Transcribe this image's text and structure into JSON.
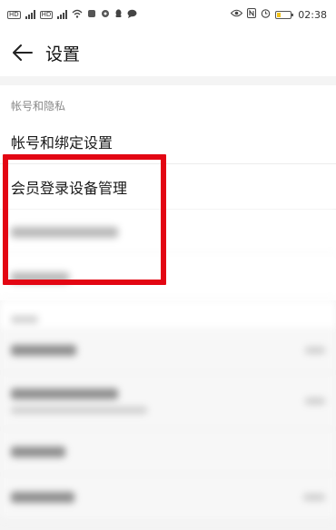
{
  "status_bar": {
    "time": "02:38",
    "left_icons": [
      "hd-icon",
      "signal-icon",
      "hd-icon",
      "signal-icon",
      "wifi-icon",
      "notification-icon",
      "location-icon",
      "qq-icon",
      "chat-icon"
    ],
    "right_icons": [
      "eye-icon",
      "nfc-icon",
      "alarm-icon",
      "battery-icon"
    ],
    "battery_level": 0.2
  },
  "header": {
    "title": "设置",
    "back_icon": "back-arrow-icon"
  },
  "account_section": {
    "header": "帐号和隐私",
    "items": [
      {
        "label": "帐号和绑定设置"
      },
      {
        "label": "会员登录设备管理"
      }
    ]
  },
  "highlight_color": "#e30613"
}
